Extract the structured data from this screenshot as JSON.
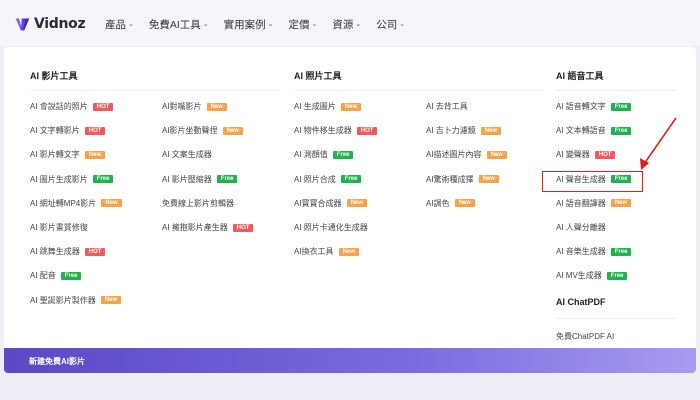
{
  "brand": {
    "name": "Vidnoz",
    "accent": "#6c4ce0"
  },
  "nav": {
    "items": [
      {
        "label": "產品",
        "has_dropdown": true
      },
      {
        "label": "免費AI工具",
        "has_dropdown": true
      },
      {
        "label": "實用案例",
        "has_dropdown": true
      },
      {
        "label": "定價",
        "has_dropdown": true
      },
      {
        "label": "資源",
        "has_dropdown": true
      },
      {
        "label": "公司",
        "has_dropdown": true
      }
    ]
  },
  "menu": {
    "video_tools": {
      "title": "AI 影片工具",
      "items": [
        {
          "label": "AI 會說話的照片",
          "badge": "HOT"
        },
        {
          "label": "AI 文字轉影片",
          "badge": "HOT"
        },
        {
          "label": "AI 影片轉文字",
          "badge": "New"
        },
        {
          "label": "AI 圖片生成影片",
          "badge": "Free"
        },
        {
          "label": "AI 網址轉MP4影片",
          "badge": "New"
        },
        {
          "label": "AI 影片畫質修復",
          "badge": ""
        },
        {
          "label": "AI 跳舞生成器",
          "badge": "HOT"
        },
        {
          "label": "AI 配音",
          "badge": "Free"
        },
        {
          "label": "AI 聖誕影片製作器",
          "badge": "New"
        },
        {
          "label": "AI對嘴影片",
          "badge": "New"
        },
        {
          "label": "AI影片坐動聲捏",
          "badge": "New"
        },
        {
          "label": "AI 文案生成器",
          "badge": ""
        },
        {
          "label": "AI 影片壓縮器",
          "badge": "Free"
        },
        {
          "label": "免費線上影片剪輯器",
          "badge": ""
        },
        {
          "label": "AI 擁抱影片產生器",
          "badge": "HOT"
        }
      ]
    },
    "photo_tools": {
      "title": "AI 照片工具",
      "items": [
        {
          "label": "AI 生成圖片",
          "badge": "New"
        },
        {
          "label": "AI 物件移生成器",
          "badge": "HOT"
        },
        {
          "label": "AI 測顏值",
          "badge": "Free"
        },
        {
          "label": "AI 照片合成",
          "badge": "Free"
        },
        {
          "label": "AI寶寶合成器",
          "badge": "New"
        },
        {
          "label": "AI 照片卡通化生成器",
          "badge": ""
        },
        {
          "label": "AI換衣工具",
          "badge": "New"
        },
        {
          "label": "AI 去背工具",
          "badge": ""
        },
        {
          "label": "AI 吉卜力濾鏡",
          "badge": "New"
        },
        {
          "label": "AI描述圖片內容",
          "badge": "New"
        },
        {
          "label": "AI驚術種成擇",
          "badge": "New"
        },
        {
          "label": "AI調色",
          "badge": "New"
        }
      ]
    },
    "voice_tools": {
      "title": "AI 語音工具",
      "items": [
        {
          "label": "AI 語音轉文字",
          "badge": "Free"
        },
        {
          "label": "AI 文本轉語音",
          "badge": "Free"
        },
        {
          "label": "AI 變聲器",
          "badge": "HOT"
        },
        {
          "label": "AI 聲音生成器",
          "badge": "Free"
        },
        {
          "label": "AI 語音翻譯器",
          "badge": "New"
        },
        {
          "label": "AI 人聲分離器",
          "badge": ""
        },
        {
          "label": "AI 音樂生成器",
          "badge": "Free"
        },
        {
          "label": "AI MV生成器",
          "badge": "Free"
        }
      ]
    },
    "chatpdf": {
      "title": "AI ChatPDF",
      "items": [
        {
          "label": "免費ChatPDF AI",
          "badge": ""
        }
      ]
    },
    "footer": {
      "label": "新建免費AI影片"
    }
  },
  "colors": {
    "hot": "#f05a5a",
    "new": "#f7a24a",
    "free": "#1fb34b",
    "annotation": "#e02020"
  }
}
